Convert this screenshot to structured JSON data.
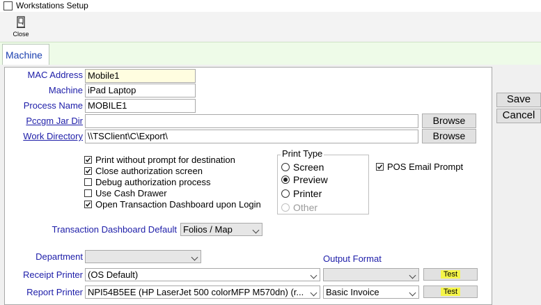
{
  "window": {
    "title": "Workstations Setup"
  },
  "toolbar": {
    "close_label": "Close"
  },
  "tabs": [
    {
      "label": "Machine"
    }
  ],
  "form": {
    "mac_address": {
      "label": "MAC Address",
      "value": "Mobile1"
    },
    "machine": {
      "label": "Machine",
      "value": "iPad Laptop"
    },
    "process_name": {
      "label": "Process Name",
      "value": "MOBILE1"
    },
    "pccgm_jar_dir": {
      "label": "Pccgm Jar Dir",
      "value": "",
      "browse": "Browse"
    },
    "work_directory": {
      "label": "Work Directory",
      "value": "\\\\TSClient\\C\\Export\\",
      "browse": "Browse"
    }
  },
  "options": [
    {
      "label": "Print without prompt for destination",
      "checked": true
    },
    {
      "label": "Close authorization screen",
      "checked": true
    },
    {
      "label": "Debug authorization process",
      "checked": false
    },
    {
      "label": "Use Cash Drawer",
      "checked": false
    },
    {
      "label": "Open Transaction Dashboard upon Login",
      "checked": true
    }
  ],
  "print_type": {
    "legend": "Print Type",
    "options": [
      {
        "label": "Screen",
        "selected": false,
        "enabled": true
      },
      {
        "label": "Preview",
        "selected": true,
        "enabled": true
      },
      {
        "label": "Printer",
        "selected": false,
        "enabled": true
      },
      {
        "label": "Other",
        "selected": false,
        "enabled": false
      }
    ]
  },
  "pos_email": {
    "label": "POS Email Prompt",
    "checked": true
  },
  "dashboard_default": {
    "label": "Transaction Dashboard Default",
    "value": "Folios / Map"
  },
  "department": {
    "label": "Department",
    "value": ""
  },
  "output_format": {
    "label": "Output Format"
  },
  "receipt_printer": {
    "label": "Receipt Printer",
    "value": "(OS Default)",
    "format": "",
    "test": "Test"
  },
  "report_printer": {
    "label": "Report Printer",
    "value": "NPI54B5EE (HP LaserJet 500 colorMFP M570dn) (r...",
    "format": "Basic Invoice",
    "test": "Test"
  },
  "actions": {
    "save": "Save",
    "cancel": "Cancel"
  },
  "colors": {
    "label_blue": "#1c1ca8",
    "highlight": "#f5f548",
    "mac_field_bg": "#fffde0"
  }
}
